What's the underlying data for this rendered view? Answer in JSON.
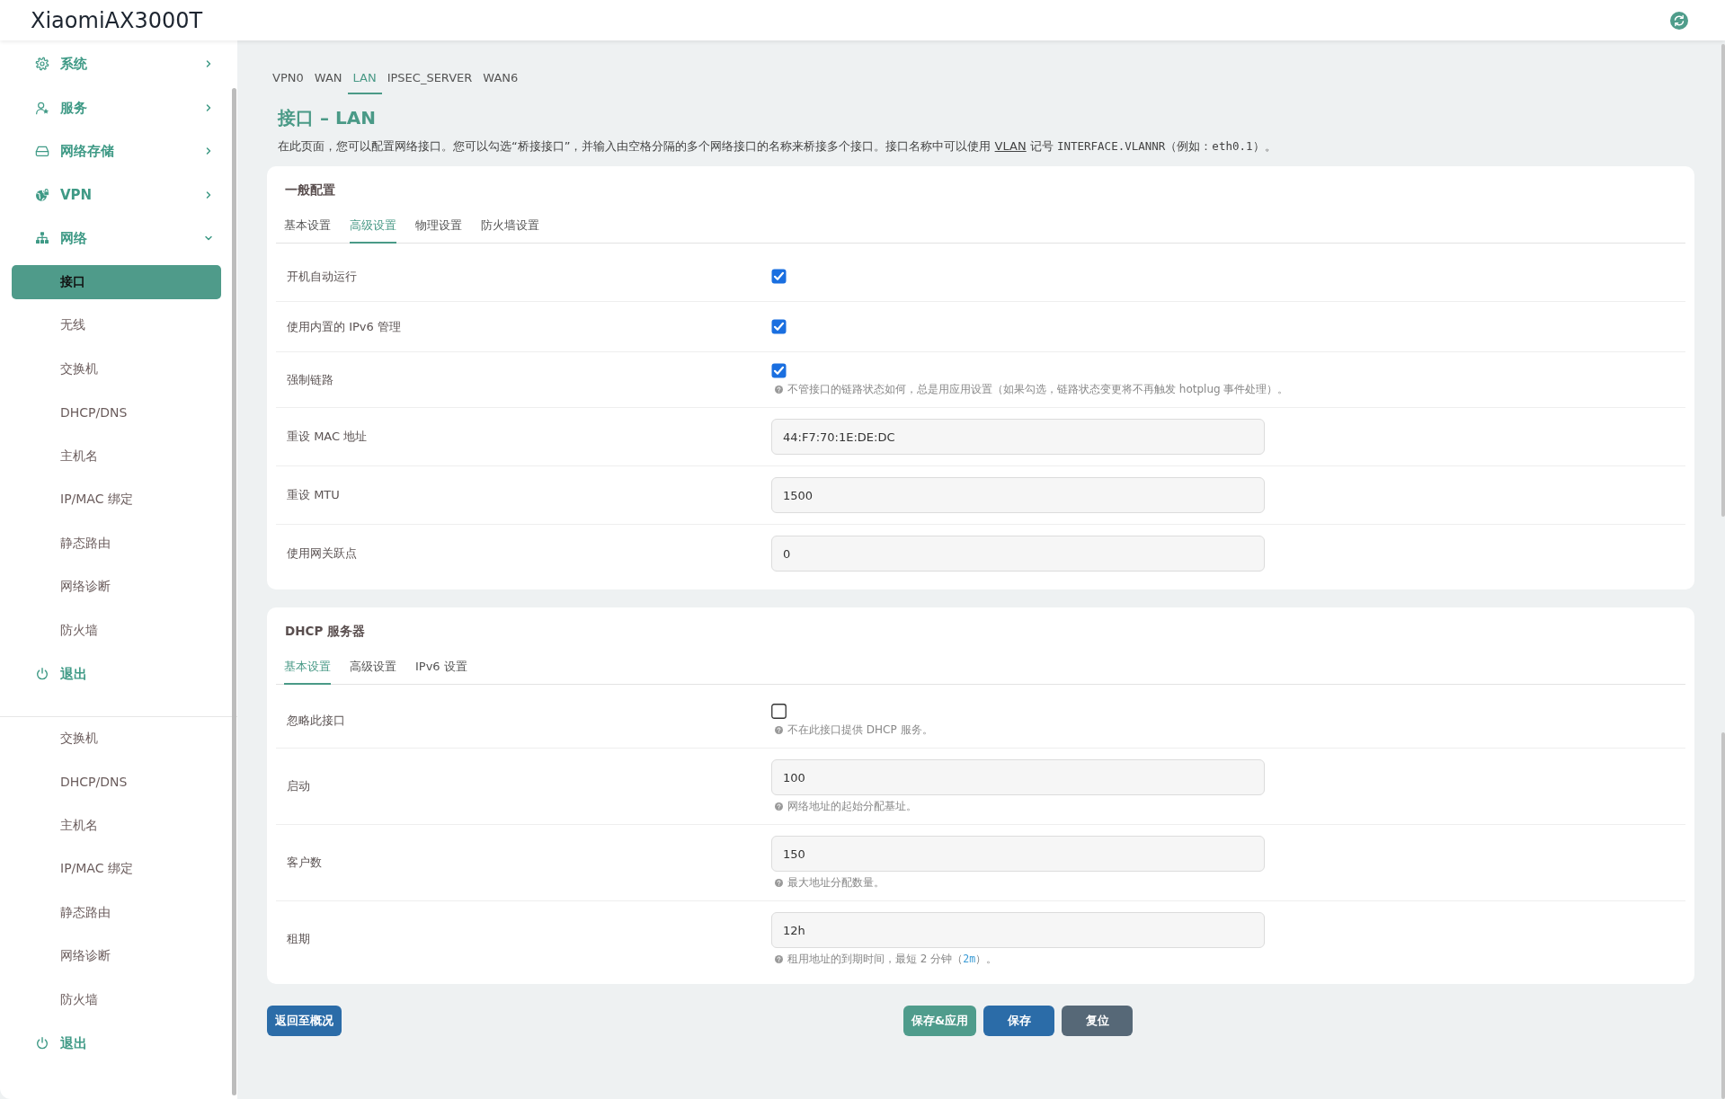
{
  "header": {
    "title": "XiaomiAX3000T"
  },
  "sidebar": {
    "items": [
      {
        "kind": "group",
        "label": "系统",
        "expanded": false
      },
      {
        "kind": "group",
        "label": "服务",
        "expanded": false
      },
      {
        "kind": "group",
        "label": "网络存储",
        "expanded": false
      },
      {
        "kind": "group",
        "label": "VPN",
        "expanded": false
      },
      {
        "kind": "group",
        "label": "网络",
        "expanded": true,
        "children": [
          {
            "label": "接口",
            "selected": true
          },
          {
            "label": "无线",
            "selected": false
          },
          {
            "label": "交换机",
            "selected": false
          },
          {
            "label": "DHCP/DNS",
            "selected": false
          },
          {
            "label": "主机名",
            "selected": false
          },
          {
            "label": "IP/MAC 绑定",
            "selected": false
          },
          {
            "label": "静态路由",
            "selected": false
          },
          {
            "label": "网络诊断",
            "selected": false
          },
          {
            "label": "防火墙",
            "selected": false
          }
        ]
      },
      {
        "kind": "logout",
        "label": "退出"
      }
    ]
  },
  "sidebar_lower": {
    "items": [
      {
        "kind": "link",
        "label": "交换机",
        "selected": false
      },
      {
        "kind": "link",
        "label": "DHCP/DNS",
        "selected": false
      },
      {
        "kind": "link",
        "label": "主机名",
        "selected": false
      },
      {
        "kind": "link",
        "label": "IP/MAC 绑定",
        "selected": false
      },
      {
        "kind": "link",
        "label": "静态路由",
        "selected": false
      },
      {
        "kind": "link",
        "label": "网络诊断",
        "selected": false
      },
      {
        "kind": "link",
        "label": "防火墙",
        "selected": false
      },
      {
        "kind": "logout",
        "label": "退出"
      }
    ]
  },
  "interface_tabs": [
    {
      "label": "VPN0",
      "selected": false
    },
    {
      "label": "WAN",
      "selected": false
    },
    {
      "label": "LAN",
      "selected": true
    },
    {
      "label": "IPSEC_SERVER",
      "selected": false
    },
    {
      "label": "WAN6",
      "selected": false
    }
  ],
  "page": {
    "title": "接口 – LAN",
    "description": [
      {
        "kind": "text",
        "text": "在此页面，您可以配置网络接口。您可以勾选“桥接接口”，并输入由空格分隔的多个网络接口的名称来桥接多个接口。接口名称中可以使用 "
      },
      {
        "kind": "term",
        "text": "VLAN"
      },
      {
        "kind": "text",
        "text": " 记号 "
      },
      {
        "kind": "code",
        "text": "INTERFACE.VLANNR"
      },
      {
        "kind": "text",
        "text": "（例如："
      },
      {
        "kind": "code",
        "text": "eth0.1"
      },
      {
        "kind": "text",
        "text": "）。"
      }
    ]
  },
  "sections": [
    {
      "title": "一般配置",
      "tabs": [
        {
          "label": "基本设置",
          "selected": false
        },
        {
          "label": "高级设置",
          "selected": true
        },
        {
          "label": "物理设置",
          "selected": false
        },
        {
          "label": "防火墙设置",
          "selected": false
        }
      ],
      "rows": [
        {
          "kind": "checkbox",
          "label": "开机自动运行",
          "checked": true
        },
        {
          "kind": "checkbox",
          "label": "使用内置的 IPv6 管理",
          "checked": true
        },
        {
          "kind": "checkbox",
          "label": "强制链路",
          "checked": true,
          "hint": "不管接口的链路状态如何，总是用应用设置（如果勾选，链路状态变更将不再触发 hotplug 事件处理）。"
        },
        {
          "kind": "text",
          "label": "重设 MAC 地址",
          "value": "44:F7:70:1E:DE:DC"
        },
        {
          "kind": "text",
          "label": "重设 MTU",
          "value": "1500"
        },
        {
          "kind": "text",
          "label": "使用网关跃点",
          "value": "0"
        }
      ]
    },
    {
      "title": "DHCP 服务器",
      "tabs": [
        {
          "label": "基本设置",
          "selected": true
        },
        {
          "label": "高级设置",
          "selected": false
        },
        {
          "label": "IPv6 设置",
          "selected": false
        }
      ],
      "rows": [
        {
          "kind": "checkbox",
          "label": "忽略此接口",
          "checked": false,
          "hint": "不在此接口提供 DHCP 服务。"
        },
        {
          "kind": "text",
          "label": "启动",
          "value": "100",
          "hint": "网络地址的起始分配基址。"
        },
        {
          "kind": "text",
          "label": "客户数",
          "value": "150",
          "hint": "最大地址分配数量。"
        },
        {
          "kind": "text",
          "label": "租期",
          "value": "12h",
          "hint": [
            {
              "kind": "text",
              "text": "租用地址的到期时间，最短 2 分钟（"
            },
            {
              "kind": "code",
              "text": "2m"
            },
            {
              "kind": "text",
              "text": "）。"
            }
          ]
        }
      ]
    }
  ],
  "actions": [
    {
      "kind": "back",
      "label": "返回至概况"
    },
    {
      "kind": "apply",
      "label": "保存&应用"
    },
    {
      "kind": "save",
      "label": "保存"
    },
    {
      "kind": "reset",
      "label": "复位"
    }
  ]
}
